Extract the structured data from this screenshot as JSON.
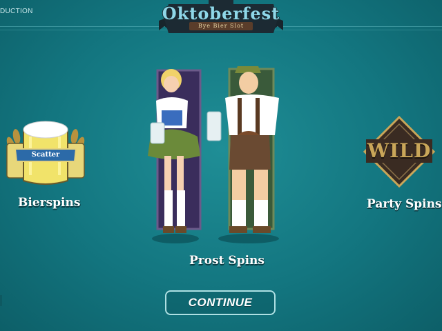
{
  "header": {
    "intro_label": "DUCTION",
    "logo_title": "Oktoberfest",
    "logo_subtitle": "Bye Bier Slot"
  },
  "features": [
    {
      "label": "Bierspins",
      "icon": "scatter-beer-mug-icon",
      "badge": "Scatter"
    },
    {
      "label": "Prost Spins",
      "icon": "oktoberfest-couple-art"
    },
    {
      "label": "Party Spins",
      "icon": "wild-symbol-icon",
      "badge": "WILD"
    }
  ],
  "actions": {
    "continue_label": "CONTINUE"
  },
  "colors": {
    "background": "#137680",
    "logo_banner": "#1c2a33",
    "button_border": "#aee0e3",
    "wild_gold": "#c9a659"
  }
}
